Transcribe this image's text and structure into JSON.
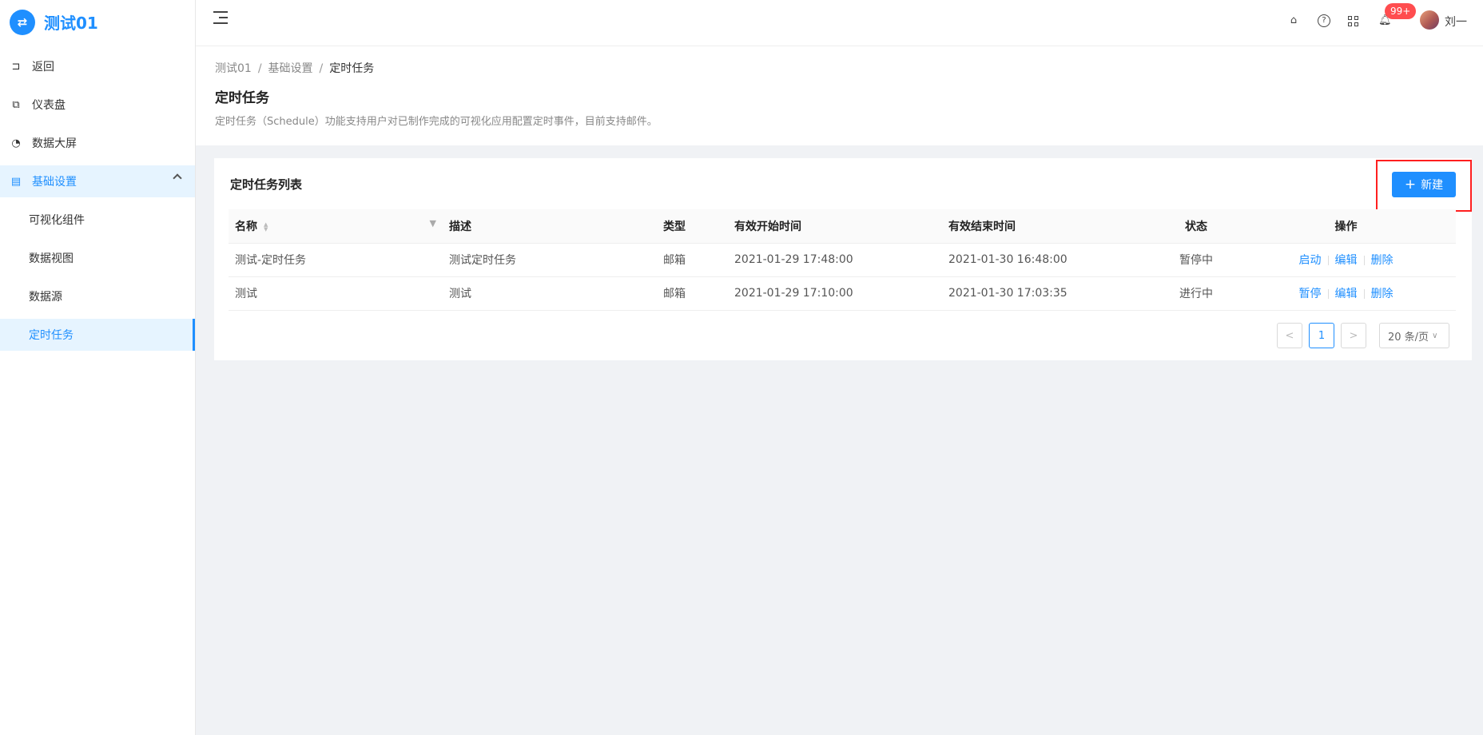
{
  "app": {
    "logo_glyph": "ቹ",
    "title": "测试01"
  },
  "sidebar": {
    "items": [
      {
        "label": "返回",
        "icon": "return-icon"
      },
      {
        "label": "仪表盘",
        "icon": "dashboard-icon"
      },
      {
        "label": "数据大屏",
        "icon": "pie-chart-icon"
      },
      {
        "label": "基础设置",
        "icon": "settings-icon",
        "expanded": true
      }
    ],
    "sub_items": [
      {
        "label": "可视化组件"
      },
      {
        "label": "数据视图"
      },
      {
        "label": "数据源"
      },
      {
        "label": "定时任务",
        "active": true
      }
    ]
  },
  "header": {
    "notification_count": "99+",
    "username": "刘一"
  },
  "breadcrumb": [
    "测试01",
    "基础设置",
    "定时任务"
  ],
  "page": {
    "title": "定时任务",
    "description": "定时任务（Schedule）功能支持用户对已制作完成的可视化应用配置定时事件，目前支持邮件。"
  },
  "card": {
    "title": "定时任务列表",
    "new_button": "新建"
  },
  "table": {
    "columns": [
      "名称",
      "描述",
      "类型",
      "有效开始时间",
      "有效结束时间",
      "状态",
      "操作"
    ],
    "rows": [
      {
        "name": "测试-定时任务",
        "desc": "测试定时任务",
        "type": "邮箱",
        "start": "2021-01-29 17:48:00",
        "end": "2021-01-30 16:48:00",
        "status": "暂停中",
        "actions": [
          "启动",
          "编辑",
          "删除"
        ]
      },
      {
        "name": "测试",
        "desc": "测试",
        "type": "邮箱",
        "start": "2021-01-29 17:10:00",
        "end": "2021-01-30 17:03:35",
        "status": "进行中",
        "actions": [
          "暂停",
          "编辑",
          "删除"
        ]
      }
    ]
  },
  "pagination": {
    "prev": "<",
    "current": "1",
    "next": ">",
    "page_size": "20 条/页"
  },
  "colors": {
    "primary": "#1f8fff",
    "highlight": "#ff1f1f",
    "badge": "#ff4d4f"
  }
}
